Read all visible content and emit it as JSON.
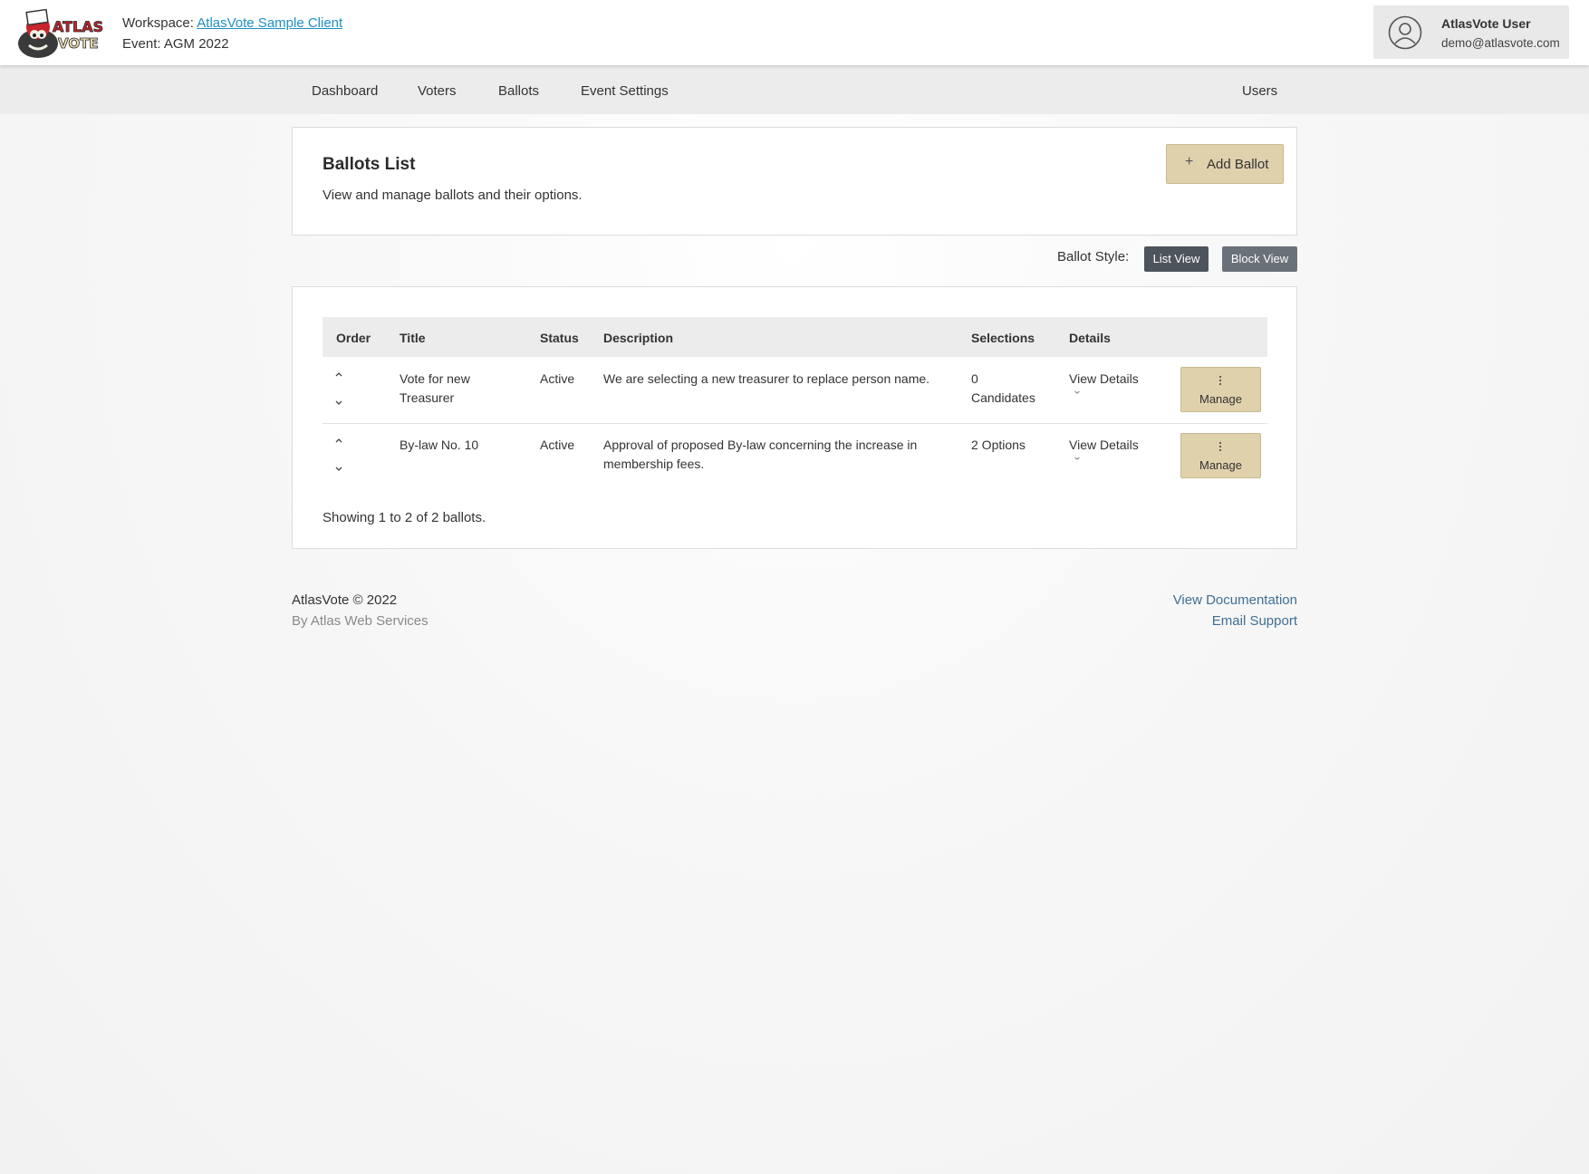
{
  "header": {
    "workspace_label": "Workspace:",
    "workspace_name": "AtlasVote Sample Client",
    "event_label": "Event: AGM 2022",
    "user_name": "AtlasVote User",
    "user_email": "demo@atlasvote.com",
    "logo_text": [
      "ATLAS",
      "VOTE"
    ]
  },
  "nav": {
    "items": [
      "Dashboard",
      "Voters",
      "Ballots",
      "Event Settings"
    ],
    "right_item": "Users"
  },
  "ballots_card": {
    "title": "Ballots List",
    "subtitle": "View and manage ballots and their options.",
    "add_button_label": "Add Ballot",
    "add_button_icon": "plus-icon"
  },
  "ballot_style": {
    "label": "Ballot Style:",
    "options": [
      "List View",
      "Block View"
    ]
  },
  "table": {
    "columns": [
      "Order",
      "Title",
      "Status",
      "Description",
      "Selections",
      "Details"
    ],
    "rows": [
      {
        "title_line1": "Vote for new",
        "title_line2": "Treasurer",
        "status": "Active",
        "description_line1": "We are selecting a new treasurer to replace person name.",
        "description_line2": "",
        "selections_line1": "0",
        "selections_line2": "Candidates",
        "details": "View Details",
        "manage": "Manage"
      },
      {
        "title_line1": "By-law No. 10",
        "title_line2": "",
        "status": "Active",
        "description_line1": "Approval of proposed By-law concerning the increase in",
        "description_line2": "membership fees.",
        "selections_line1": "2 Options",
        "selections_line2": "",
        "details": "View Details",
        "manage": "Manage"
      }
    ],
    "summary": "Showing 1 to 2 of 2 ballots."
  },
  "footer": {
    "copyright": "AtlasVote © 2022",
    "by_line": "By Atlas Web Services",
    "links": [
      "View Documentation",
      "Email Support"
    ]
  },
  "colors": {
    "accent_button": "#e0d1ad",
    "link": "#1e8fc6",
    "footer_link": "#3f6f96",
    "style_button": "#5a6068"
  }
}
